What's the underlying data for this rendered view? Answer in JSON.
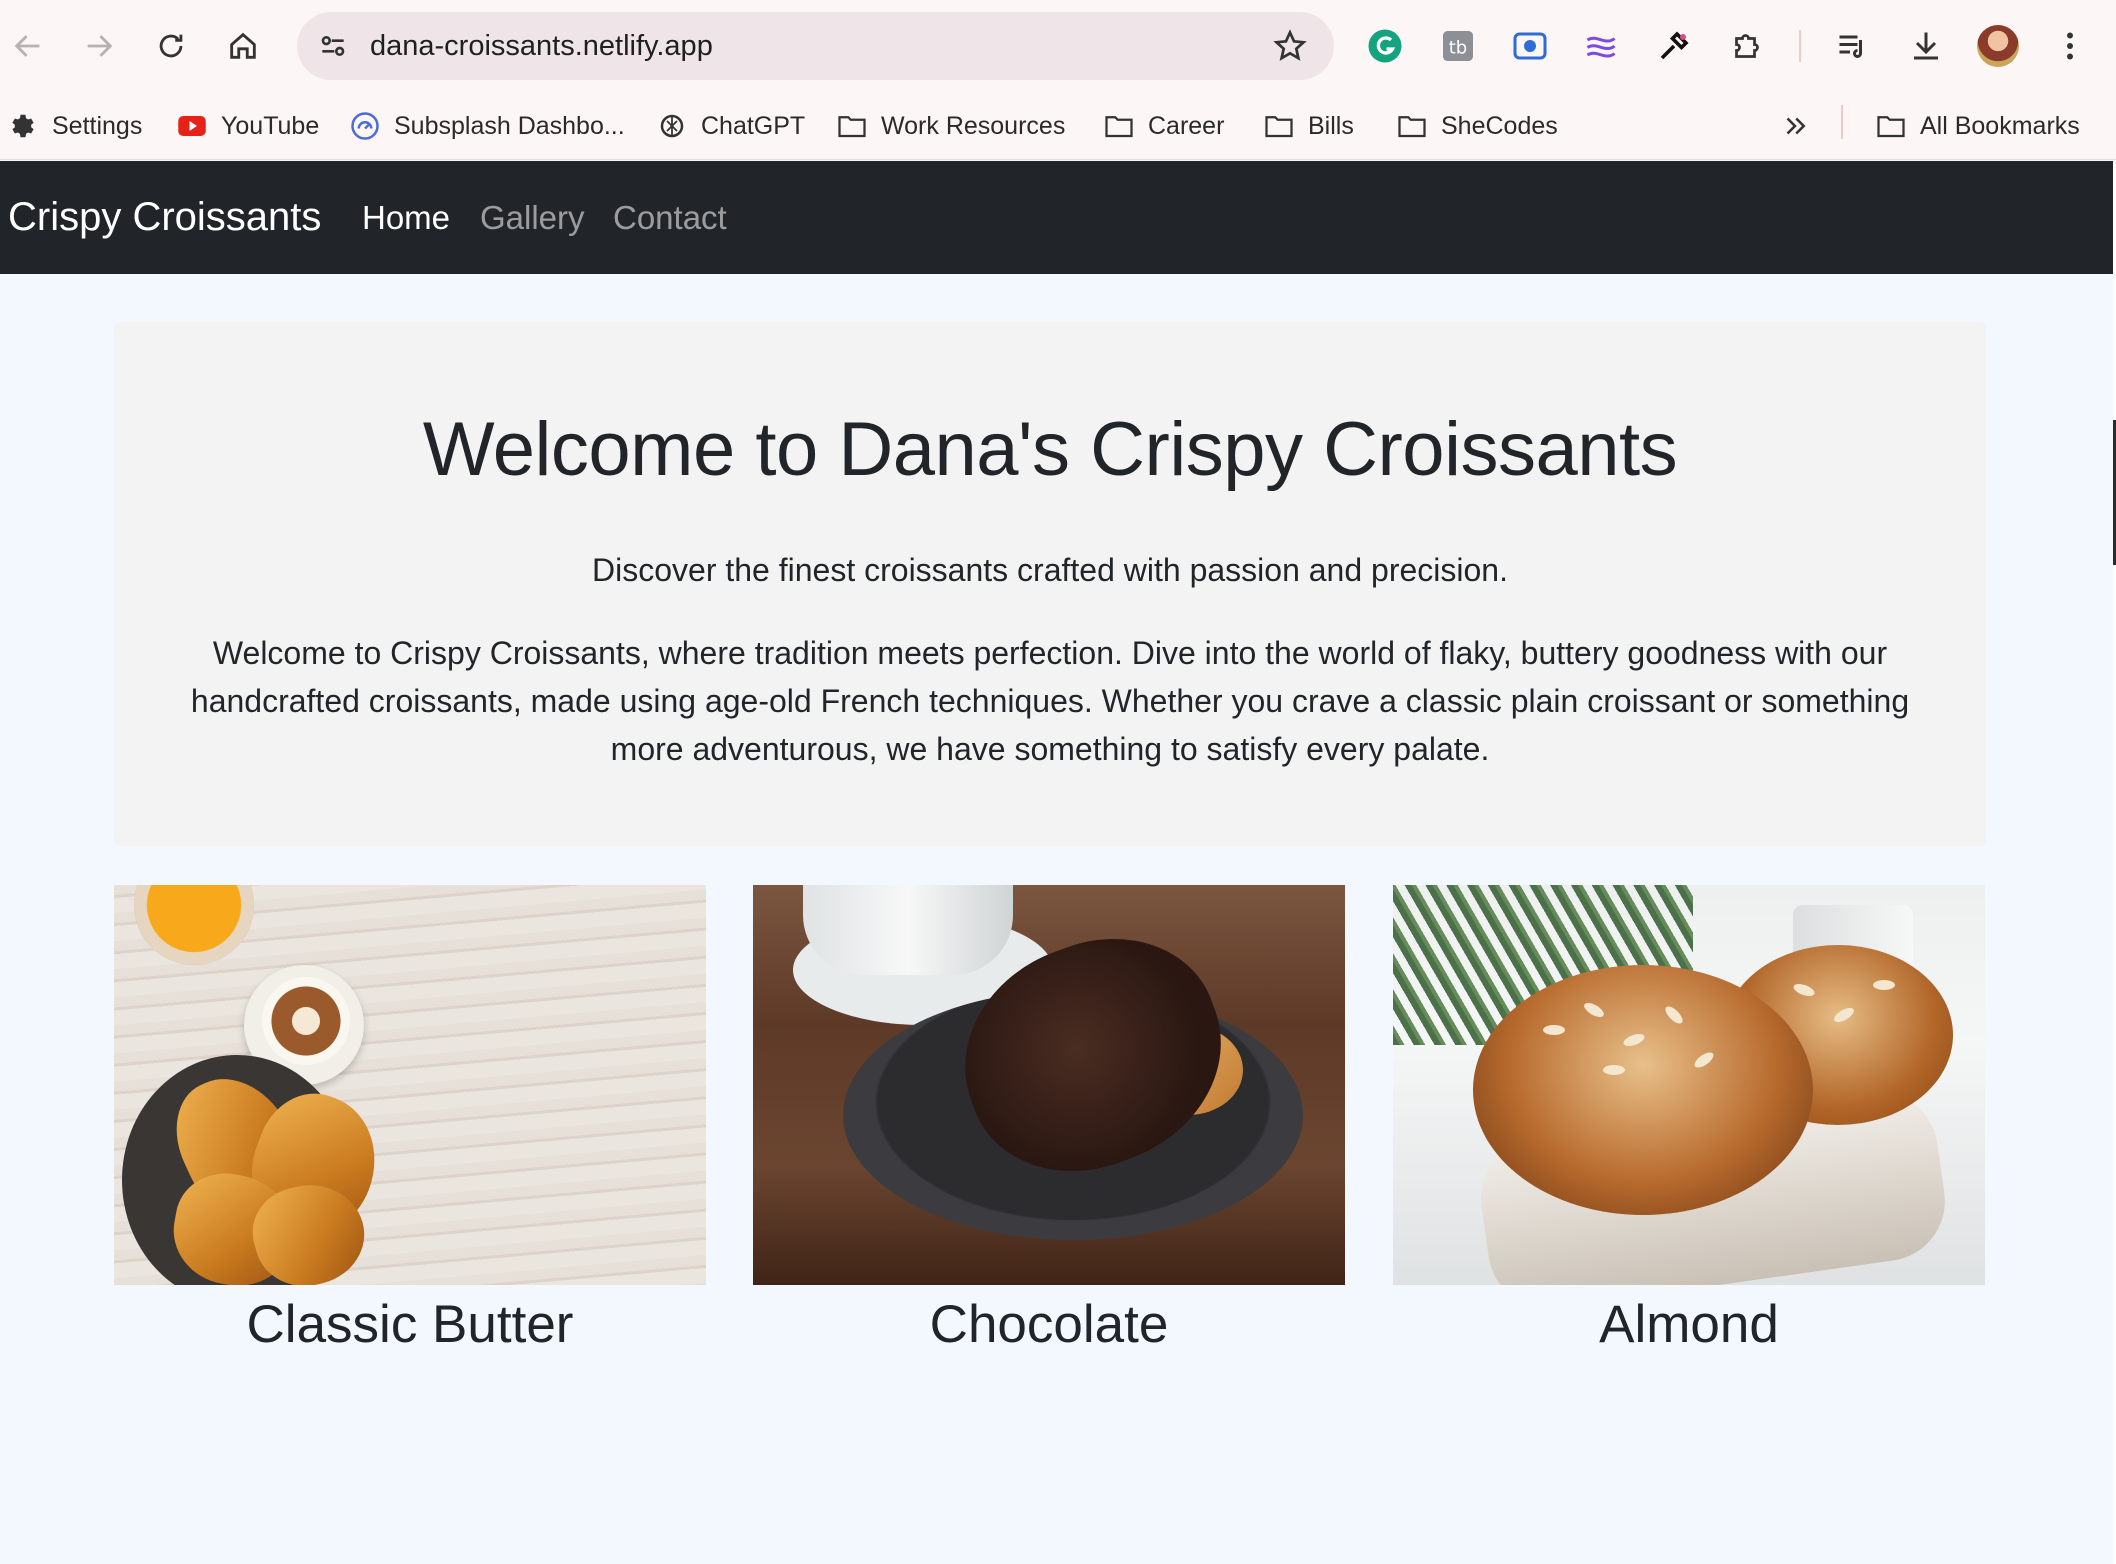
{
  "browser": {
    "url": "dana-croissants.netlify.app",
    "bookmarks": [
      {
        "label": "Settings",
        "icon": "gear-icon"
      },
      {
        "label": "YouTube",
        "icon": "youtube-icon"
      },
      {
        "label": "Subsplash Dashbo...",
        "icon": "subsplash-icon"
      },
      {
        "label": "ChatGPT",
        "icon": "chatgpt-icon"
      },
      {
        "label": "Work Resources",
        "icon": "folder-icon"
      },
      {
        "label": "Career",
        "icon": "folder-icon"
      },
      {
        "label": "Bills",
        "icon": "folder-icon"
      },
      {
        "label": "SheCodes",
        "icon": "folder-icon"
      }
    ],
    "all_bookmarks": "All Bookmarks"
  },
  "navbar": {
    "brand": "Crispy Croissants",
    "links": [
      {
        "label": "Home",
        "active": true
      },
      {
        "label": "Gallery",
        "active": false
      },
      {
        "label": "Contact",
        "active": false
      }
    ]
  },
  "hero": {
    "title": "Welcome to Dana's Crispy Croissants",
    "lead": "Discover the finest croissants crafted with passion and precision.",
    "body": "Welcome to Crispy Croissants, where tradition meets perfection. Dive into the world of flaky, buttery goodness with our handcrafted croissants, made using age-old French techniques. Whether you crave a classic plain croissant or something more adventurous, we have something to satisfy every palate."
  },
  "products": [
    {
      "title": "Classic Butter"
    },
    {
      "title": "Chocolate"
    },
    {
      "title": "Almond"
    }
  ],
  "colors": {
    "navbar_bg": "#212529",
    "page_bg": "#f2f8fe",
    "hero_bg": "#f3f3f3",
    "chrome_bg": "#fdf6f6"
  }
}
